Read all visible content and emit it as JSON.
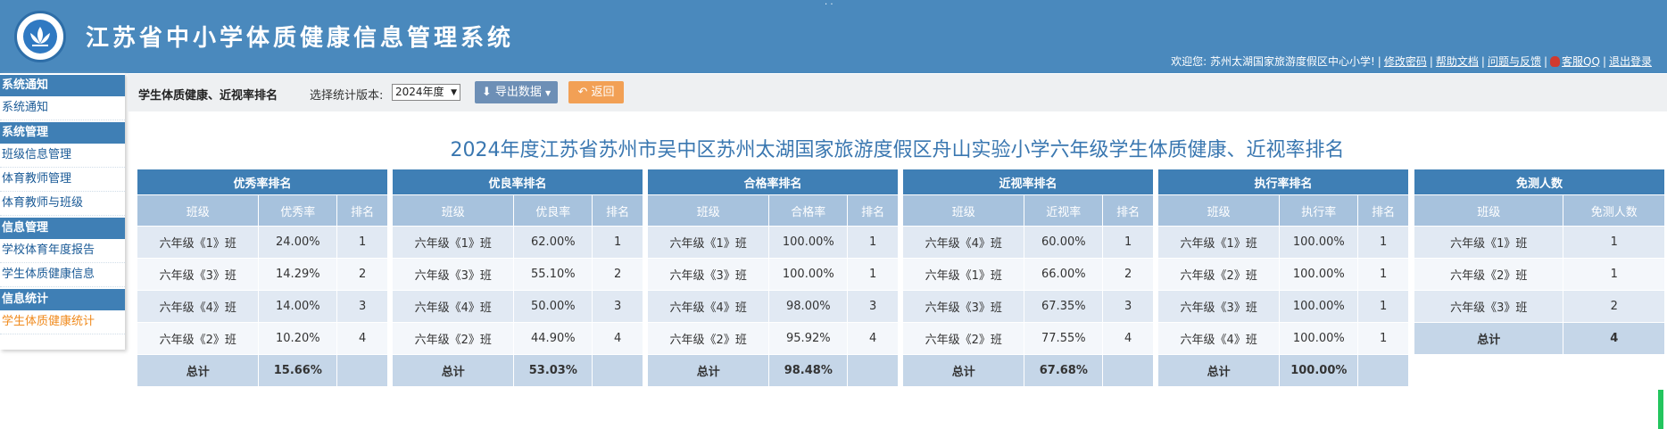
{
  "header": {
    "system_title": "江苏省中小学体质健康信息管理系统",
    "top_dots": "· ·",
    "welcome": "欢迎您: 苏州太湖国家旅游度假区中心小学!",
    "links": [
      "修改密码",
      "帮助文档",
      "问题与反馈",
      "客服QQ",
      "退出登录"
    ]
  },
  "sidebar": {
    "groups": [
      {
        "title": "系统通知",
        "items": [
          "系统通知"
        ]
      },
      {
        "title": "系统管理",
        "items": [
          "班级信息管理",
          "体育教师管理",
          "体育教师与班级"
        ]
      },
      {
        "title": "信息管理",
        "items": [
          "学校体育年度报告",
          "学生体质健康信息"
        ]
      },
      {
        "title": "信息统计",
        "items": [
          "学生体质健康统计"
        ]
      }
    ],
    "active_item": "学生体质健康统计"
  },
  "toolbar": {
    "title": "学生体质健康、近视率排名",
    "version_label": "选择统计版本:",
    "version_value": "2024年度",
    "export_label": "导出数据",
    "back_label": "返回"
  },
  "report_title": "2024年度江苏省苏州市吴中区苏州太湖国家旅游度假区舟山实验小学六年级学生体质健康、近视率排名",
  "tables": [
    {
      "caption": "优秀率排名",
      "columns": [
        "班级",
        "优秀率",
        "排名"
      ],
      "rows": [
        [
          "六年级《1》班",
          "24.00%",
          "1"
        ],
        [
          "六年级《3》班",
          "14.29%",
          "2"
        ],
        [
          "六年级《4》班",
          "14.00%",
          "3"
        ],
        [
          "六年级《2》班",
          "10.20%",
          "4"
        ]
      ],
      "total": [
        "总计",
        "15.66%",
        ""
      ]
    },
    {
      "caption": "优良率排名",
      "columns": [
        "班级",
        "优良率",
        "排名"
      ],
      "rows": [
        [
          "六年级《1》班",
          "62.00%",
          "1"
        ],
        [
          "六年级《3》班",
          "55.10%",
          "2"
        ],
        [
          "六年级《4》班",
          "50.00%",
          "3"
        ],
        [
          "六年级《2》班",
          "44.90%",
          "4"
        ]
      ],
      "total": [
        "总计",
        "53.03%",
        ""
      ]
    },
    {
      "caption": "合格率排名",
      "columns": [
        "班级",
        "合格率",
        "排名"
      ],
      "rows": [
        [
          "六年级《1》班",
          "100.00%",
          "1"
        ],
        [
          "六年级《3》班",
          "100.00%",
          "1"
        ],
        [
          "六年级《4》班",
          "98.00%",
          "3"
        ],
        [
          "六年级《2》班",
          "95.92%",
          "4"
        ]
      ],
      "total": [
        "总计",
        "98.48%",
        ""
      ]
    },
    {
      "caption": "近视率排名",
      "columns": [
        "班级",
        "近视率",
        "排名"
      ],
      "rows": [
        [
          "六年级《4》班",
          "60.00%",
          "1"
        ],
        [
          "六年级《1》班",
          "66.00%",
          "2"
        ],
        [
          "六年级《3》班",
          "67.35%",
          "3"
        ],
        [
          "六年级《2》班",
          "77.55%",
          "4"
        ]
      ],
      "total": [
        "总计",
        "67.68%",
        ""
      ]
    },
    {
      "caption": "执行率排名",
      "columns": [
        "班级",
        "执行率",
        "排名"
      ],
      "rows": [
        [
          "六年级《1》班",
          "100.00%",
          "1"
        ],
        [
          "六年级《2》班",
          "100.00%",
          "1"
        ],
        [
          "六年级《3》班",
          "100.00%",
          "1"
        ],
        [
          "六年级《4》班",
          "100.00%",
          "1"
        ]
      ],
      "total": [
        "总计",
        "100.00%",
        ""
      ]
    },
    {
      "caption": "免测人数",
      "columns": [
        "班级",
        "免测人数"
      ],
      "rows": [
        [
          "六年级《1》班",
          "1"
        ],
        [
          "六年级《2》班",
          "1"
        ],
        [
          "六年级《3》班",
          "2"
        ]
      ],
      "total": [
        "总计",
        "4"
      ]
    }
  ]
}
